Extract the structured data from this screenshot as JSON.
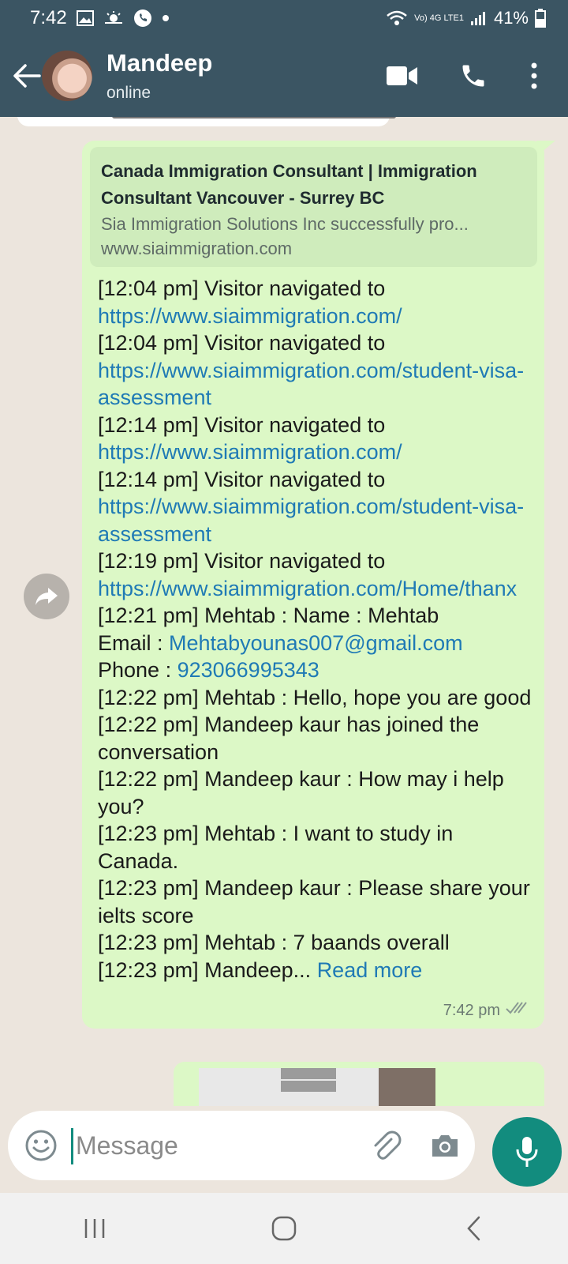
{
  "status_bar": {
    "time": "7:42",
    "network_label": "Vo) 4G LTE1",
    "battery": "41%"
  },
  "header": {
    "contact_name": "Mandeep",
    "contact_status": "online",
    "icons": [
      "back-arrow-icon",
      "video-call-icon",
      "phone-icon",
      "more-options-icon"
    ]
  },
  "message": {
    "link_preview": {
      "title": "Canada Immigration Consultant | Immigration Consultant Vancouver - Surrey BC",
      "description": "Sia Immigration Solutions Inc successfully pro...",
      "domain": "www.siaimmigration.com"
    },
    "lines": [
      {
        "text": "[12:04 pm] Visitor navigated to ",
        "link": "https://www.siaimmigration.com/"
      },
      {
        "text": "[12:04 pm] Visitor navigated to ",
        "link": "https://www.siaimmigration.com/student-visa-assessment"
      },
      {
        "text": "[12:14 pm] Visitor navigated to ",
        "link": "https://www.siaimmigration.com/"
      },
      {
        "text": "[12:14 pm] Visitor navigated to ",
        "link": "https://www.siaimmigration.com/student-visa-assessment"
      },
      {
        "text": "[12:19 pm] Visitor navigated to ",
        "link": "https://www.siaimmigration.com/Home/thanx"
      },
      {
        "text": "[12:21 pm] Mehtab : Name : Mehtab"
      },
      {
        "text": "Email : ",
        "link": "Mehtabyounas007@gmail.com"
      },
      {
        "text": "Phone : ",
        "link": "923066995343"
      },
      {
        "text": "[12:22 pm] Mehtab : Hello, hope you are good"
      },
      {
        "text": "[12:22 pm] Mandeep kaur has joined the conversation"
      },
      {
        "text": "[12:22 pm] Mandeep kaur : How may i help you?"
      },
      {
        "text": "[12:23 pm] Mehtab : I want to study in Canada."
      },
      {
        "text": "[12:23 pm] Mandeep kaur : Please share your ielts score"
      },
      {
        "text": "[12:23 pm] Mehtab : 7 baands overall"
      },
      {
        "text": "[12:23 pm] Mandeep... ",
        "link": "Read more"
      }
    ],
    "time": "7:42 pm"
  },
  "input": {
    "placeholder": "Message"
  },
  "colors": {
    "header": "#3b5563",
    "bubble": "#dcf8c6",
    "accent": "#128c7e",
    "link": "#1f7ab5"
  }
}
